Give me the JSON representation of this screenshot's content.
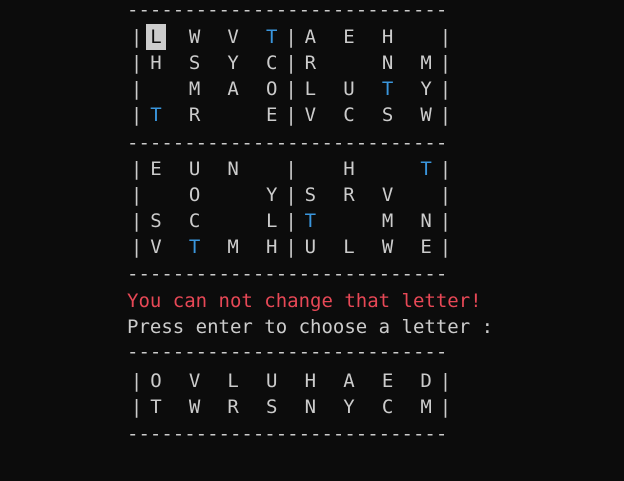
{
  "board": {
    "separator": "----------------------------",
    "rows": [
      {
        "cells": [
          "|",
          "L",
          " ",
          "W",
          " ",
          "V",
          " ",
          "T",
          "|",
          "A",
          " ",
          "E",
          " ",
          "H",
          " ",
          " ",
          "|"
        ],
        "cursor": [
          1
        ],
        "teal": [
          7
        ]
      },
      {
        "cells": [
          "|",
          "H",
          " ",
          "S",
          " ",
          "Y",
          " ",
          "C",
          "|",
          "R",
          " ",
          " ",
          " ",
          "N",
          " ",
          "M",
          "|"
        ],
        "cursor": [],
        "teal": []
      },
      {
        "cells": [
          "|",
          " ",
          " ",
          "M",
          " ",
          "A",
          " ",
          "O",
          "|",
          "L",
          " ",
          "U",
          " ",
          "T",
          " ",
          "Y",
          "|"
        ],
        "cursor": [],
        "teal": [
          13
        ]
      },
      {
        "cells": [
          "|",
          "T",
          " ",
          "R",
          " ",
          " ",
          " ",
          "E",
          "|",
          "V",
          " ",
          "C",
          " ",
          "S",
          " ",
          "W",
          "|"
        ],
        "cursor": [],
        "teal": [
          1
        ]
      },
      {
        "cells": [
          "|",
          "E",
          " ",
          "U",
          " ",
          "N",
          " ",
          " ",
          "|",
          " ",
          " ",
          "H",
          " ",
          " ",
          " ",
          "T",
          "|"
        ],
        "cursor": [],
        "teal": [
          15
        ]
      },
      {
        "cells": [
          "|",
          " ",
          " ",
          "O",
          " ",
          " ",
          " ",
          "Y",
          "|",
          "S",
          " ",
          "R",
          " ",
          "V",
          " ",
          " ",
          "|"
        ],
        "cursor": [],
        "teal": []
      },
      {
        "cells": [
          "|",
          "S",
          " ",
          "C",
          " ",
          " ",
          " ",
          "L",
          "|",
          "T",
          " ",
          " ",
          " ",
          "M",
          " ",
          "N",
          "|"
        ],
        "cursor": [],
        "teal": [
          9
        ]
      },
      {
        "cells": [
          "|",
          "V",
          " ",
          "T",
          " ",
          "M",
          " ",
          "H",
          "|",
          "U",
          " ",
          "L",
          " ",
          "W",
          " ",
          "E",
          "|"
        ],
        "cursor": [],
        "teal": [
          3
        ]
      }
    ]
  },
  "messages": {
    "error": "You can not change that letter!",
    "prompt": "Press enter to choose a letter :"
  },
  "letter_bank": {
    "separator": "----------------------------",
    "rows": [
      {
        "cells": [
          "|",
          "O",
          " ",
          "V",
          " ",
          "L",
          " ",
          "U",
          " ",
          "H",
          " ",
          "A",
          " ",
          "E",
          " ",
          "D",
          "|"
        ]
      },
      {
        "cells": [
          "|",
          "T",
          " ",
          "W",
          " ",
          "R",
          " ",
          "S",
          " ",
          "N",
          " ",
          "Y",
          " ",
          "C",
          " ",
          "M",
          "|"
        ]
      }
    ]
  },
  "colors": {
    "background": "#0c0c0c",
    "text": "#cccccc",
    "teal": "#3a96dd",
    "error": "#e74856",
    "cursor_bg": "#cccccc"
  }
}
